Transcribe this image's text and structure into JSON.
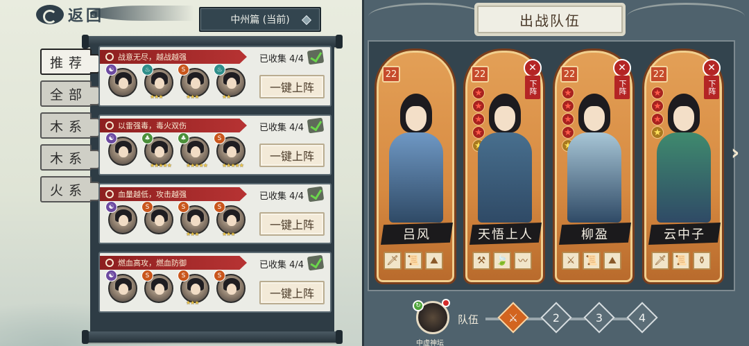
{
  "header": {
    "back_label": "返回",
    "chapter": "中州篇 (当前)"
  },
  "tabs": [
    {
      "label": "推荐",
      "active": true
    },
    {
      "label": "全部",
      "active": false
    },
    {
      "label": "木系",
      "active": false
    },
    {
      "label": "木系",
      "active": false
    },
    {
      "label": "火系",
      "active": false
    }
  ],
  "combos": [
    {
      "title": "战意无尽，越战越强",
      "collected": "已收集 4/4",
      "button": "一键上阵",
      "heroes": [
        {
          "element": "purple",
          "glyph": "☯",
          "stars": ""
        },
        {
          "element": "teal",
          "glyph": "♨",
          "stars": "★★★"
        },
        {
          "element": "orange",
          "glyph": "S",
          "stars": "★★★"
        },
        {
          "element": "teal",
          "glyph": "♨",
          "stars": "★★"
        }
      ]
    },
    {
      "title": "以雷强毒，毒火双伤",
      "collected": "已收集 4/4",
      "button": "一键上阵",
      "heroes": [
        {
          "element": "purple",
          "glyph": "☯",
          "stars": ""
        },
        {
          "element": "green",
          "glyph": "♣",
          "stars": "★★★★★"
        },
        {
          "element": "green",
          "glyph": "♣",
          "stars": "★★★★★"
        },
        {
          "element": "orange",
          "glyph": "S",
          "stars": "★★★★★"
        }
      ]
    },
    {
      "title": "血量越低，攻击越强",
      "collected": "已收集 4/4",
      "button": "一键上阵",
      "heroes": [
        {
          "element": "purple",
          "glyph": "☯",
          "stars": ""
        },
        {
          "element": "orange",
          "glyph": "S",
          "stars": ""
        },
        {
          "element": "orange",
          "glyph": "S",
          "stars": "★★★"
        },
        {
          "element": "orange",
          "glyph": "S",
          "stars": "★★★"
        }
      ]
    },
    {
      "title": "燃血高攻，燃血防御",
      "collected": "已收集 4/4",
      "button": "一键上阵",
      "heroes": [
        {
          "element": "purple",
          "glyph": "☯",
          "stars": ""
        },
        {
          "element": "orange",
          "glyph": "S",
          "stars": ""
        },
        {
          "element": "orange",
          "glyph": "S",
          "stars": "★★★"
        },
        {
          "element": "orange",
          "glyph": "S",
          "stars": ""
        }
      ]
    }
  ],
  "team": {
    "title": "出战队伍",
    "remove_label": "下阵",
    "members": [
      {
        "name": "吕风",
        "level": "22",
        "removable": false,
        "red_stars": 0,
        "gold_stars": 0,
        "robe": "#6f98c4",
        "items": [
          "🗡",
          "📜",
          "⛰"
        ]
      },
      {
        "name": "天悟上人",
        "level": "22",
        "removable": true,
        "red_stars": 4,
        "gold_stars": 1,
        "robe": "#486f8e",
        "items": [
          "⚒",
          "🍃",
          "〰"
        ]
      },
      {
        "name": "柳盈",
        "level": "22",
        "removable": true,
        "red_stars": 4,
        "gold_stars": 1,
        "robe": "#a8c6d6",
        "items": [
          "⚔",
          "📜",
          "⛰"
        ]
      },
      {
        "name": "云中子",
        "level": "22",
        "removable": true,
        "red_stars": 3,
        "gold_stars": 1,
        "robe": "#3f8a6e",
        "items": [
          "🗡",
          "📜",
          "⚱"
        ]
      }
    ],
    "bar_label": "队伍",
    "altar_label": "中虚神坛",
    "slots": [
      "2",
      "3",
      "4"
    ]
  },
  "icons": {
    "back": "swirl-back-icon",
    "next": "chevron-right-icon",
    "check": "check-icon",
    "zoom": "magnifier-icon",
    "close": "close-icon"
  }
}
